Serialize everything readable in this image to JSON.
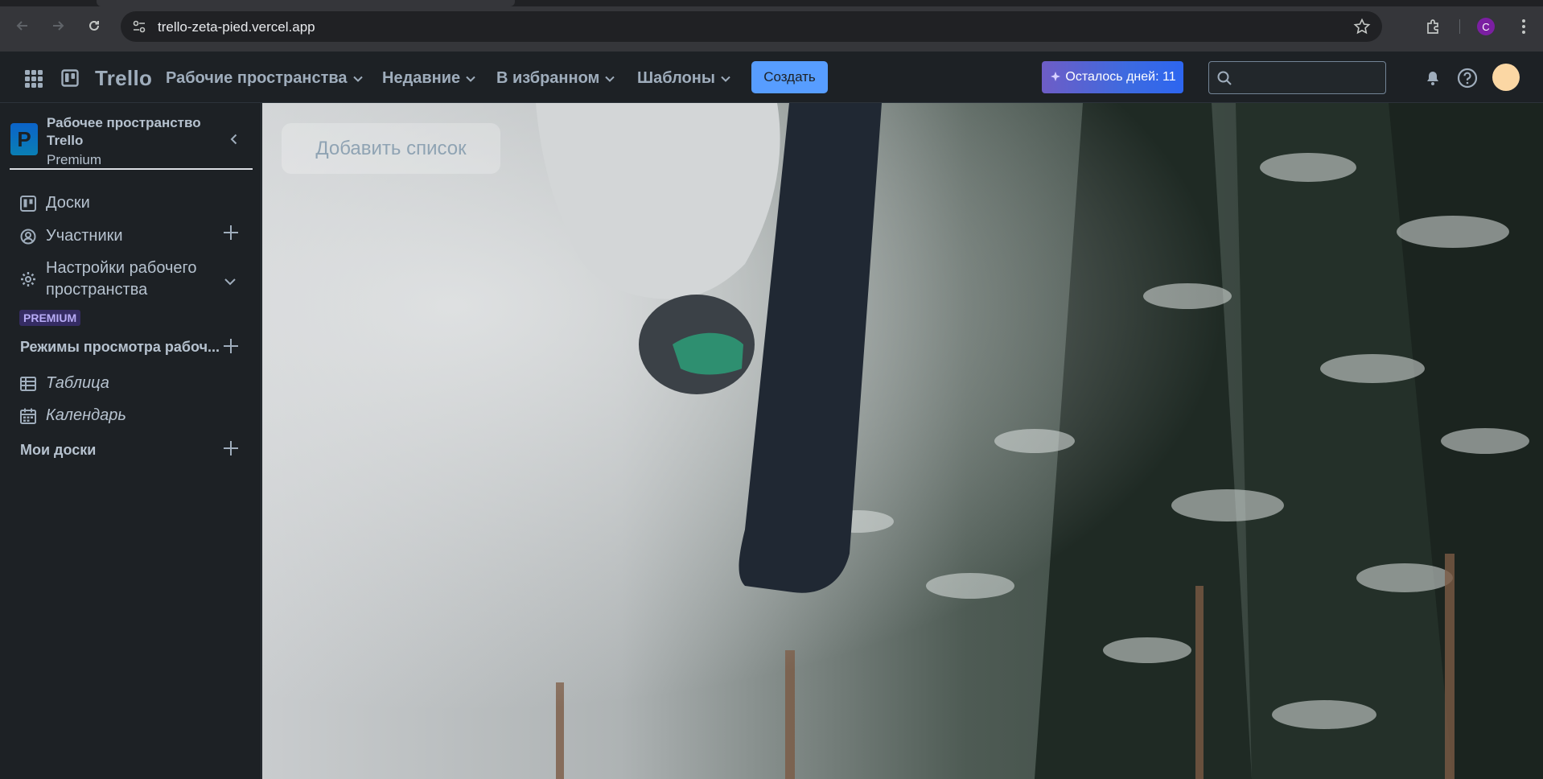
{
  "browser": {
    "url": "trello-zeta-pied.vercel.app",
    "profile_initial": "C",
    "icons": [
      "back-icon",
      "forward-icon",
      "reload-icon",
      "site-info-icon",
      "bookmark-star-icon",
      "extensions-icon",
      "browser-menu-icon"
    ]
  },
  "header": {
    "logo": "Trello",
    "menus": [
      {
        "label": "Рабочие пространства"
      },
      {
        "label": "Недавние"
      },
      {
        "label": "В избранном"
      },
      {
        "label": "Шаблоны"
      }
    ],
    "create_label": "Создать",
    "trial_label": "Осталось дней: 11",
    "search_placeholder": "",
    "accent_color": "#579dff"
  },
  "sidebar": {
    "workspace_initial": "P",
    "workspace_name": "Рабочее пространство Trello",
    "workspace_plan": "Premium",
    "items": [
      {
        "label": "Доски",
        "icon": "board-icon"
      },
      {
        "label": "Участники",
        "icon": "member-icon"
      },
      {
        "label": "Настройки рабочего пространства",
        "icon": "gear-icon"
      }
    ],
    "premium_badge": "PREMIUM",
    "views_title": "Режимы просмотра рабоч...",
    "views": [
      {
        "label": "Таблица",
        "icon": "table-icon"
      },
      {
        "label": "Календарь",
        "icon": "calendar-icon"
      }
    ],
    "my_boards_title": "Мои доски"
  },
  "board": {
    "add_list_label": "Добавить список"
  }
}
